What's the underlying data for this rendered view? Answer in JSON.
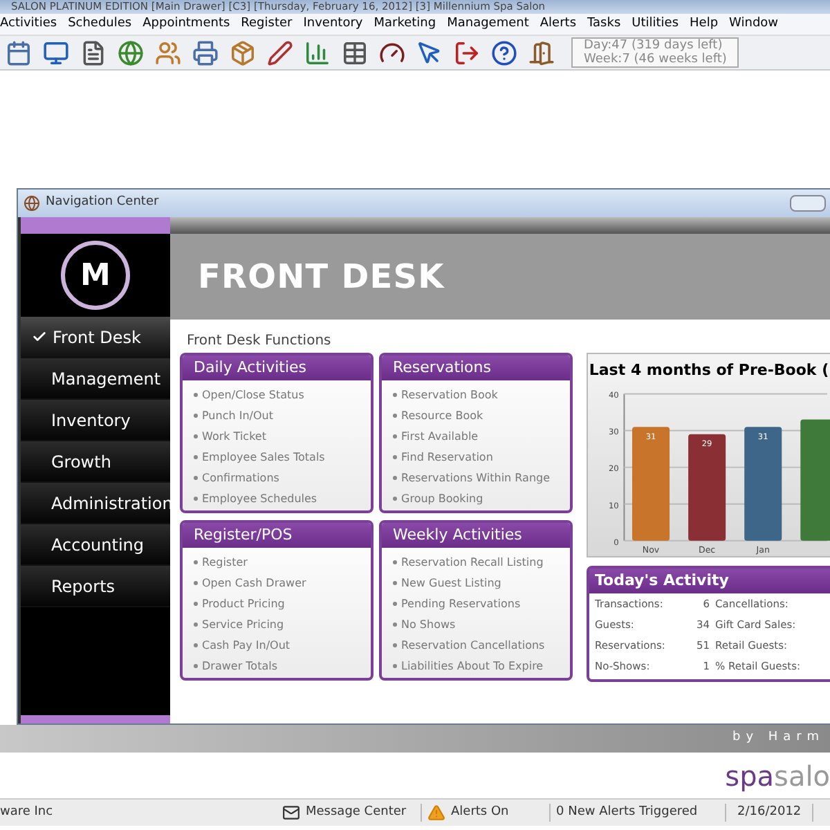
{
  "app_title": "SALON PLATINUM EDITION [Main Drawer] [C3] [Thursday, February 16, 2012] [3] Millennium Spa Salon",
  "menu": [
    "Activities",
    "Schedules",
    "Appointments",
    "Register",
    "Inventory",
    "Marketing",
    "Management",
    "Alerts",
    "Tasks",
    "Utilities",
    "Help",
    "Window"
  ],
  "toolbar": [
    {
      "kind": "calendar"
    },
    {
      "kind": "monitor"
    },
    {
      "kind": "file"
    },
    {
      "kind": "globe"
    },
    {
      "kind": "users"
    },
    {
      "kind": "printer"
    },
    {
      "kind": "package"
    },
    {
      "kind": "pen"
    },
    {
      "kind": "chart"
    },
    {
      "kind": "table"
    },
    {
      "kind": "gauge"
    },
    {
      "kind": "pointer"
    },
    {
      "kind": "exit"
    },
    {
      "kind": "help"
    },
    {
      "kind": "door"
    }
  ],
  "day_counter": [
    "Day:47 (319 days left)",
    "Week:7 (46 weeks left)"
  ],
  "window": {
    "title": "Navigation Center"
  },
  "logo": {
    "text": "M"
  },
  "sidebar": [
    {
      "label": "Front Desk",
      "selected": true
    },
    {
      "label": "Management",
      "selected": false
    },
    {
      "label": "Inventory",
      "selected": false
    },
    {
      "label": "Growth",
      "selected": false
    },
    {
      "label": "Administration",
      "selected": false
    },
    {
      "label": "Accounting",
      "selected": false
    },
    {
      "label": "Reports",
      "selected": false
    }
  ],
  "header": {
    "title": "FRONT DESK"
  },
  "section_title": "Front Desk Functions",
  "cards": [
    {
      "title": "Daily Activities",
      "items": [
        "Open/Close Status",
        "Punch In/Out",
        "Work Ticket",
        "Employee Sales Totals",
        "Confirmations",
        "Employee Schedules"
      ]
    },
    {
      "title": "Reservations",
      "items": [
        "Reservation Book",
        "Resource Book",
        "First Available",
        "Find Reservation",
        "Reservations Within Range",
        "Group Booking"
      ]
    },
    {
      "title": "Register/POS",
      "items": [
        "Register",
        "Open Cash Drawer",
        "Product Pricing",
        "Service Pricing",
        "Cash Pay In/Out",
        "Drawer Totals"
      ]
    },
    {
      "title": "Weekly Activities",
      "items": [
        "Reservation Recall Listing",
        "New Guest Listing",
        "Pending Reservations",
        "No Shows",
        "Reservation Cancellations",
        "Liabilities About To Expire"
      ]
    }
  ],
  "chart": {
    "chart_data": {
      "type": "bar",
      "title": "Last 4 months of Pre-Book (",
      "categories": [
        "Nov",
        "Dec",
        "Jan",
        null
      ],
      "series": [
        {
          "color": "#c8742a",
          "values": [
            31,
            null,
            null,
            null
          ]
        },
        {
          "color": "#8a3034",
          "values": [
            null,
            29,
            null,
            null
          ]
        },
        {
          "color": "#3d6688",
          "values": [
            null,
            null,
            31,
            null
          ]
        },
        {
          "color": "#3f7a3a",
          "values": [
            null,
            null,
            null,
            33
          ]
        }
      ],
      "ylim": [
        0,
        40
      ],
      "yticks": [
        0,
        10,
        20,
        30,
        40
      ],
      "grid": true,
      "value_labels": [
        "31",
        "29",
        "31",
        null
      ]
    }
  },
  "activity": {
    "title": "Today's Activity",
    "rows": [
      {
        "label": "Transactions:",
        "value": "6",
        "label_2": "Cancellations:"
      },
      {
        "label": "Guests:",
        "value": "34",
        "label_2": "Gift Card Sales:"
      },
      {
        "label": "Reservations:",
        "value": "51",
        "label_2": "Retail Guests:"
      },
      {
        "label": "No-Shows:",
        "value": "1",
        "label_2": "% Retail Guests:"
      }
    ]
  },
  "footer_band": "by Harm",
  "brand": {
    "part_1": "spa",
    "part_2": "salo"
  },
  "status_bar": {
    "company": "ware Inc",
    "message_center": "Message Center",
    "alerts": "Alerts On",
    "new_alerts": "0 New Alerts Triggered",
    "date": "2/16/2012"
  }
}
